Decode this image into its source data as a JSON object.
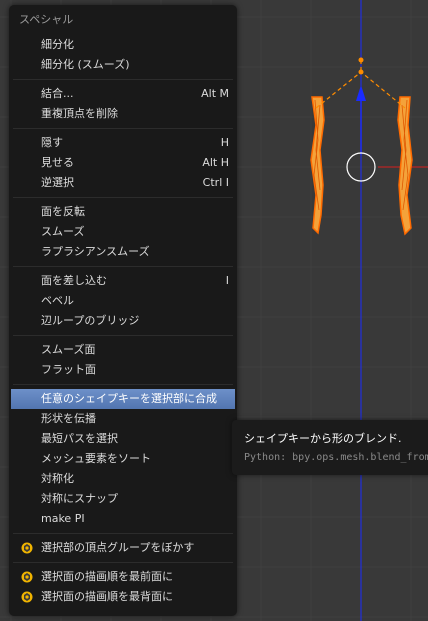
{
  "colors": {
    "viewport_bg": "#393939",
    "grid": "#404040",
    "menu_bg": "#191919",
    "highlight": "#5f83bf",
    "mesh_orange": "#ff8c00",
    "axis_blue": "#1a2bff",
    "axis_red": "#d62020"
  },
  "menu": {
    "title": "スペシャル",
    "sections": [
      [
        {
          "label": "細分化",
          "shortcut": ""
        },
        {
          "label": "細分化 (スムーズ)",
          "shortcut": ""
        }
      ],
      [
        {
          "label": "結合...",
          "shortcut": "Alt M"
        },
        {
          "label": "重複頂点を削除",
          "shortcut": ""
        }
      ],
      [
        {
          "label": "隠す",
          "shortcut": "H"
        },
        {
          "label": "見せる",
          "shortcut": "Alt H"
        },
        {
          "label": "逆選択",
          "shortcut": "Ctrl I"
        }
      ],
      [
        {
          "label": "面を反転",
          "shortcut": ""
        },
        {
          "label": "スムーズ",
          "shortcut": ""
        },
        {
          "label": "ラプラシアンスムーズ",
          "shortcut": ""
        }
      ],
      [
        {
          "label": "面を差し込む",
          "shortcut": "I"
        },
        {
          "label": "ベベル",
          "shortcut": ""
        },
        {
          "label": "辺ループのブリッジ",
          "shortcut": ""
        }
      ],
      [
        {
          "label": "スムーズ面",
          "shortcut": ""
        },
        {
          "label": "フラット面",
          "shortcut": ""
        }
      ],
      [
        {
          "label": "任意のシェイプキーを選択部に合成",
          "shortcut": "",
          "active": true
        },
        {
          "label": "形状を伝播",
          "shortcut": ""
        },
        {
          "label": "最短パスを選択",
          "shortcut": ""
        },
        {
          "label": "メッシュ要素をソート",
          "shortcut": ""
        },
        {
          "label": "対称化",
          "shortcut": ""
        },
        {
          "label": "対称にスナップ",
          "shortcut": ""
        },
        {
          "label": "make PI",
          "shortcut": ""
        }
      ],
      [
        {
          "label": "選択部の頂点グループをぼかす",
          "shortcut": "",
          "icon": "python-addon-icon"
        }
      ],
      [
        {
          "label": "選択面の描画順を最前面に",
          "shortcut": "",
          "icon": "python-addon-icon"
        },
        {
          "label": "選択面の描画順を最背面に",
          "shortcut": "",
          "icon": "python-addon-icon"
        }
      ]
    ]
  },
  "tooltip": {
    "title": "シェイプキーから形のブレンド.",
    "python": "Python: bpy.ops.mesh.blend_from_shape()"
  }
}
